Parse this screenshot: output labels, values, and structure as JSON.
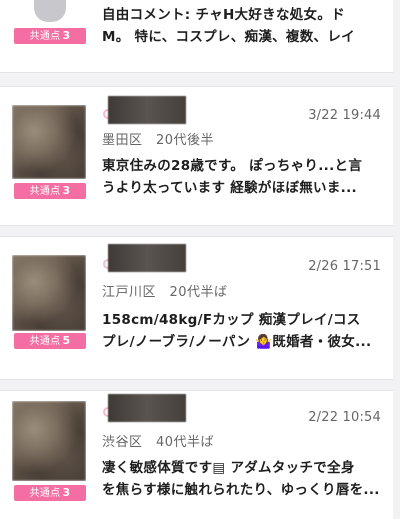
{
  "badge_label": "共通点",
  "cards": [
    {
      "badge_count": "3",
      "comment_lines": [
        "自由コメント: チャH大好きな処女。ド",
        "M。 特に、コスプレ、痴漢、複数、レイ"
      ]
    },
    {
      "date": "3/22 19:44",
      "meta": "墨田区　20代後半",
      "badge_count": "3",
      "comment_lines": [
        "東京住みの28歳です。 ぽっちゃり...と言",
        "うより太っています 経験がほぼ無いま..."
      ]
    },
    {
      "date": "2/26 17:51",
      "meta": "江戸川区　20代半ば",
      "badge_count": "5",
      "comment_lines": [
        "158cm/48kg/Fカップ 痴漢プレイ/コス",
        "プレ/ノーブラ/ノーパン 🤷‍♀️既婚者・彼女..."
      ]
    },
    {
      "date": "2/22 10:54",
      "meta": "渋谷区　40代半ば",
      "badge_count": "3",
      "comment_lines": [
        "凄く敏感体質です▤ アダムタッチで全身",
        "を焦らす様に触れられたり、ゆっくり唇を..."
      ]
    }
  ]
}
